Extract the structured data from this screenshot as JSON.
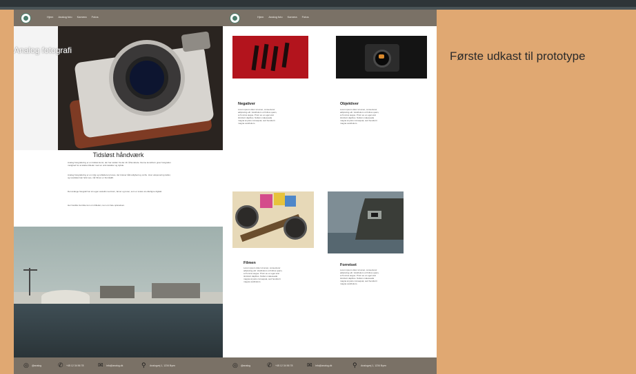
{
  "annotation": {
    "title": "Første udkast til prototype"
  },
  "left_page": {
    "nav_items": [
      "Hjem",
      "Analog foto",
      "Kamera",
      "Fotos"
    ],
    "hero_title": "Analog fotografi",
    "section_title": "Tidsløst håndværk",
    "paragraphs": [
      "Analog fotografering er en tidsløs kunst, der har rødder fra det 19. århundrede. Denne kunstform giver fotografen mulighed for at skabe billeder med en unik karakter og dybde.",
      "Analog fotografering er en rolig og reflekteret proces, der kræver tålmodighed og omhu. Hver eksponering tæller, og resultatet kan først ses, når filmen er fremkaldt.",
      "Det analoge fotografi har sin egen æstetik med korn, farver og toner, som er svære at efterligne digitalt.",
      "Her handler det ikke kun om billedet, men om hele oplevelsen."
    ],
    "footer": {
      "instagram": "@analog",
      "phone": "+45 12 34 56 78",
      "email": "info@analog.dk",
      "address": "Analogvej 1, 1234 Byen"
    }
  },
  "right_page": {
    "nav_items": [
      "Hjem",
      "Analog foto",
      "Kamera",
      "Fotos"
    ],
    "cards": [
      {
        "title": "Negativer",
        "text": "Lorem ipsum dolor sit amet, consectetur adipiscing elit. Vestibulum ut finibus quam, a rhoncus augue. Proin eu ex eget erat tincidunt dapibus. Nullam malesuada magna at justo consequat, sed hendrerit magna vestibulum."
      },
      {
        "title": "Objektiver",
        "text": "Lorem ipsum dolor sit amet, consectetur adipiscing elit. Vestibulum ut finibus quam, a rhoncus augue. Proin eu ex eget erat tincidunt dapibus. Nullam malesuada magna at justo consequat, sed hendrerit magna vestibulum."
      },
      {
        "title": "Filmen",
        "text": "Lorem ipsum dolor sit amet, consectetur adipiscing elit. Vestibulum ut finibus quam, a rhoncus augue. Proin eu ex eget erat tincidunt dapibus. Nullam malesuada magna at justo consequat, sed hendrerit magna vestibulum."
      },
      {
        "title": "Forretset",
        "text": "Lorem ipsum dolor sit amet, consectetur adipiscing elit. Vestibulum ut finibus quam, a rhoncus augue. Proin eu ex eget erat tincidunt dapibus. Nullam malesuada magna at justo consequat, sed hendrerit magna vestibulum."
      }
    ],
    "footer": {
      "instagram": "@analog",
      "phone": "+45 12 34 56 78",
      "email": "info@analog.dk",
      "address": "Analogvej 1, 1234 Byen"
    }
  },
  "colors": {
    "background_accent": "#e0a872",
    "nav_brown": "#7a7166",
    "logo_green": "#4c7e6d"
  },
  "icons": [
    "instagram-icon",
    "phone-icon",
    "email-icon",
    "location-pin-icon",
    "logo-icon"
  ]
}
